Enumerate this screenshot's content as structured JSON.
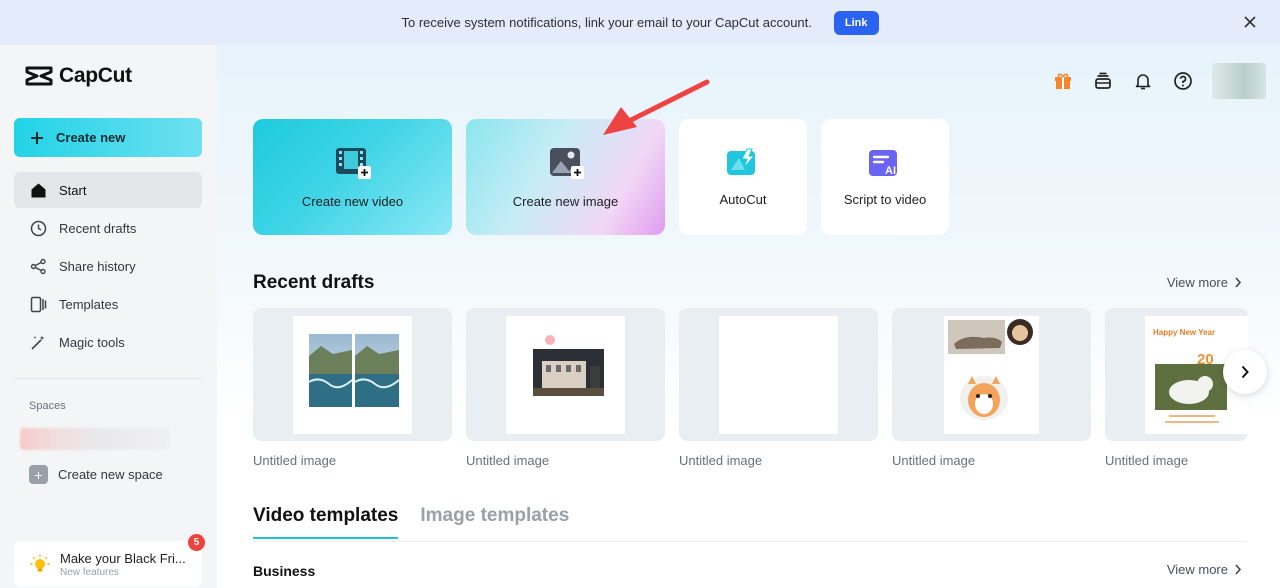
{
  "banner": {
    "message": "To receive system notifications, link your email to your CapCut account.",
    "link_label": "Link"
  },
  "sidebar": {
    "logo_text": "CapCut",
    "create_new_label": "Create new",
    "items": [
      {
        "label": "Start",
        "icon": "home-icon"
      },
      {
        "label": "Recent drafts",
        "icon": "clock-icon"
      },
      {
        "label": "Share history",
        "icon": "share-icon"
      },
      {
        "label": "Templates",
        "icon": "templates-icon"
      },
      {
        "label": "Magic tools",
        "icon": "magic-wand-icon"
      }
    ],
    "spaces_label": "Spaces",
    "create_space_label": "Create new space",
    "promo": {
      "title": "Make your Black Fri...",
      "subtitle": "New features",
      "badge": "5"
    }
  },
  "main": {
    "create_cards": [
      {
        "label": "Create new video",
        "icon": "film-plus-icon"
      },
      {
        "label": "Create new image",
        "icon": "image-plus-icon"
      },
      {
        "label": "AutoCut",
        "icon": "autocut-icon"
      },
      {
        "label": "Script to video",
        "icon": "script-ai-icon"
      }
    ],
    "recent_drafts": {
      "title": "Recent drafts",
      "view_more": "View more",
      "items": [
        {
          "name": "Untitled image"
        },
        {
          "name": "Untitled image"
        },
        {
          "name": "Untitled image"
        },
        {
          "name": "Untitled image"
        },
        {
          "name": "Untitled image",
          "caption": "Happy New Year"
        }
      ]
    },
    "template_tabs": [
      {
        "label": "Video templates",
        "active": true
      },
      {
        "label": "Image templates",
        "active": false
      }
    ],
    "business": {
      "title": "Business",
      "view_more": "View more"
    }
  },
  "colors": {
    "accent": "#22d3e6",
    "link_button": "#2b63f1",
    "gift": "#f5862e",
    "arrow": "#ee4343",
    "badge": "#f0413a"
  }
}
